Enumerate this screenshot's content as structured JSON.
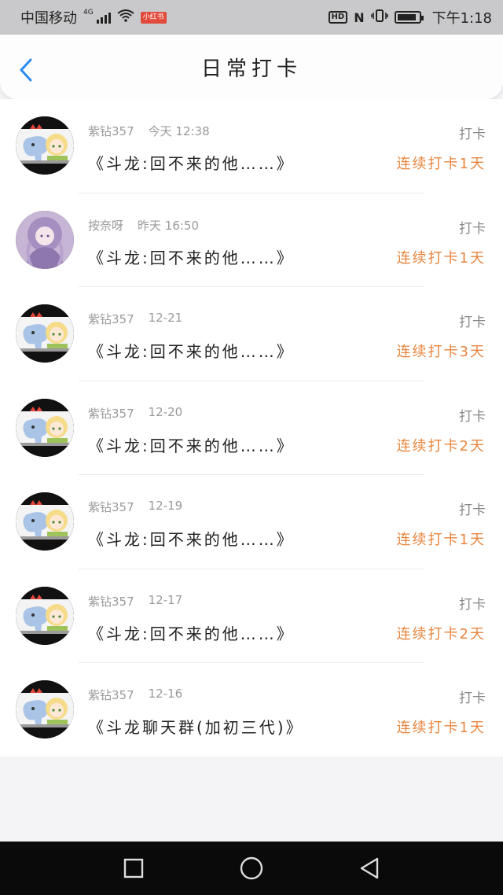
{
  "status_bar": {
    "carrier": "中国移动",
    "network": "4G",
    "app_tag": "小红书",
    "hd_label": "HD",
    "nfc_label": "N",
    "time": "下午1:18"
  },
  "header": {
    "title": "日常打卡"
  },
  "records": [
    {
      "user": "紫钻357",
      "date": "今天 12:38",
      "text": "《斗龙:回不来的他……》",
      "label": "打卡",
      "streak": "连续打卡1天",
      "avatar": "elephant"
    },
    {
      "user": "按奈呀",
      "date": "昨天 16:50",
      "text": "《斗龙:回不来的他……》",
      "label": "打卡",
      "streak": "连续打卡1天",
      "avatar": "purple"
    },
    {
      "user": "紫钻357",
      "date": "12-21",
      "text": "《斗龙:回不来的他……》",
      "label": "打卡",
      "streak": "连续打卡3天",
      "avatar": "elephant"
    },
    {
      "user": "紫钻357",
      "date": "12-20",
      "text": "《斗龙:回不来的他……》",
      "label": "打卡",
      "streak": "连续打卡2天",
      "avatar": "elephant"
    },
    {
      "user": "紫钻357",
      "date": "12-19",
      "text": "《斗龙:回不来的他……》",
      "label": "打卡",
      "streak": "连续打卡1天",
      "avatar": "elephant"
    },
    {
      "user": "紫钻357",
      "date": "12-17",
      "text": "《斗龙:回不来的他……》",
      "label": "打卡",
      "streak": "连续打卡2天",
      "avatar": "elephant"
    },
    {
      "user": "紫钻357",
      "date": "12-16",
      "text": "《斗龙聊天群(加初三代)》",
      "label": "打卡",
      "streak": "连续打卡1天",
      "avatar": "elephant"
    }
  ],
  "colors": {
    "accent_blue": "#2a8cf0",
    "streak_orange": "#e8853e"
  }
}
